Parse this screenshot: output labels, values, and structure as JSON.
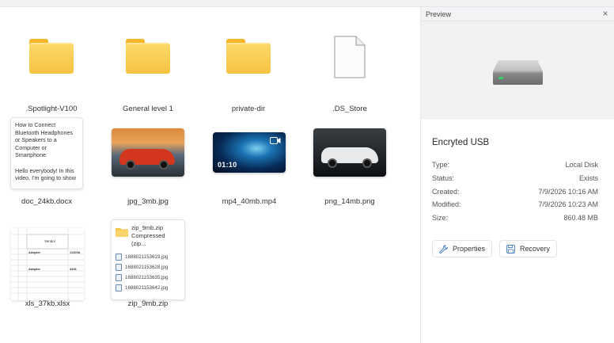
{
  "preview": {
    "title": "Preview",
    "close_icon": "×",
    "device_name": "Encryted USB",
    "properties": [
      {
        "key": "Type:",
        "value": "Local Disk"
      },
      {
        "key": "Status:",
        "value": "Exists"
      },
      {
        "key": "Created:",
        "value": "7/9/2026 10:16 AM"
      },
      {
        "key": "Modified:",
        "value": "7/9/2026 10:23 AM"
      },
      {
        "key": "Size:",
        "value": "860.48 MB"
      }
    ],
    "buttons": {
      "properties": "Properties",
      "recovery": "Recovery"
    }
  },
  "files": {
    "spotlight": ".Spotlight-V100",
    "general": "General level 1",
    "private": "private-dir",
    "ds_store": ".DS_Store",
    "doc": "doc_24kb.docx",
    "jpg": "jpg_3mb.jpg",
    "mp4": "mp4_40mb.mp4",
    "png": "png_14mb.png",
    "xls": "xls_37kb.xlsx",
    "zip": "zip_9mb.zip"
  },
  "doc_preview": {
    "para1": "How to Connect Bluetooth Headphones or Speakers to a Computer or Smartphone",
    "para2": "Hello everybody! In this video, I'm going to show"
  },
  "video": {
    "duration": "01:10"
  },
  "xls_preview": {
    "header": "Vendor",
    "rows": [
      "Adapter",
      "Adapter"
    ],
    "codes": [
      "11100A",
      "3401"
    ]
  },
  "zip_preview": {
    "title": "zip_9mb.zip",
    "subtitle": "Compressed (zip...",
    "entries": [
      "1688021153619.jpg",
      "1688021153628.jpg",
      "1688021153635.jpg",
      "1688021153642.jpg"
    ]
  },
  "colors": {
    "folder": "#f6c342",
    "accent_blue": "#3a78c2",
    "panel_bg": "#f2f3f5"
  }
}
